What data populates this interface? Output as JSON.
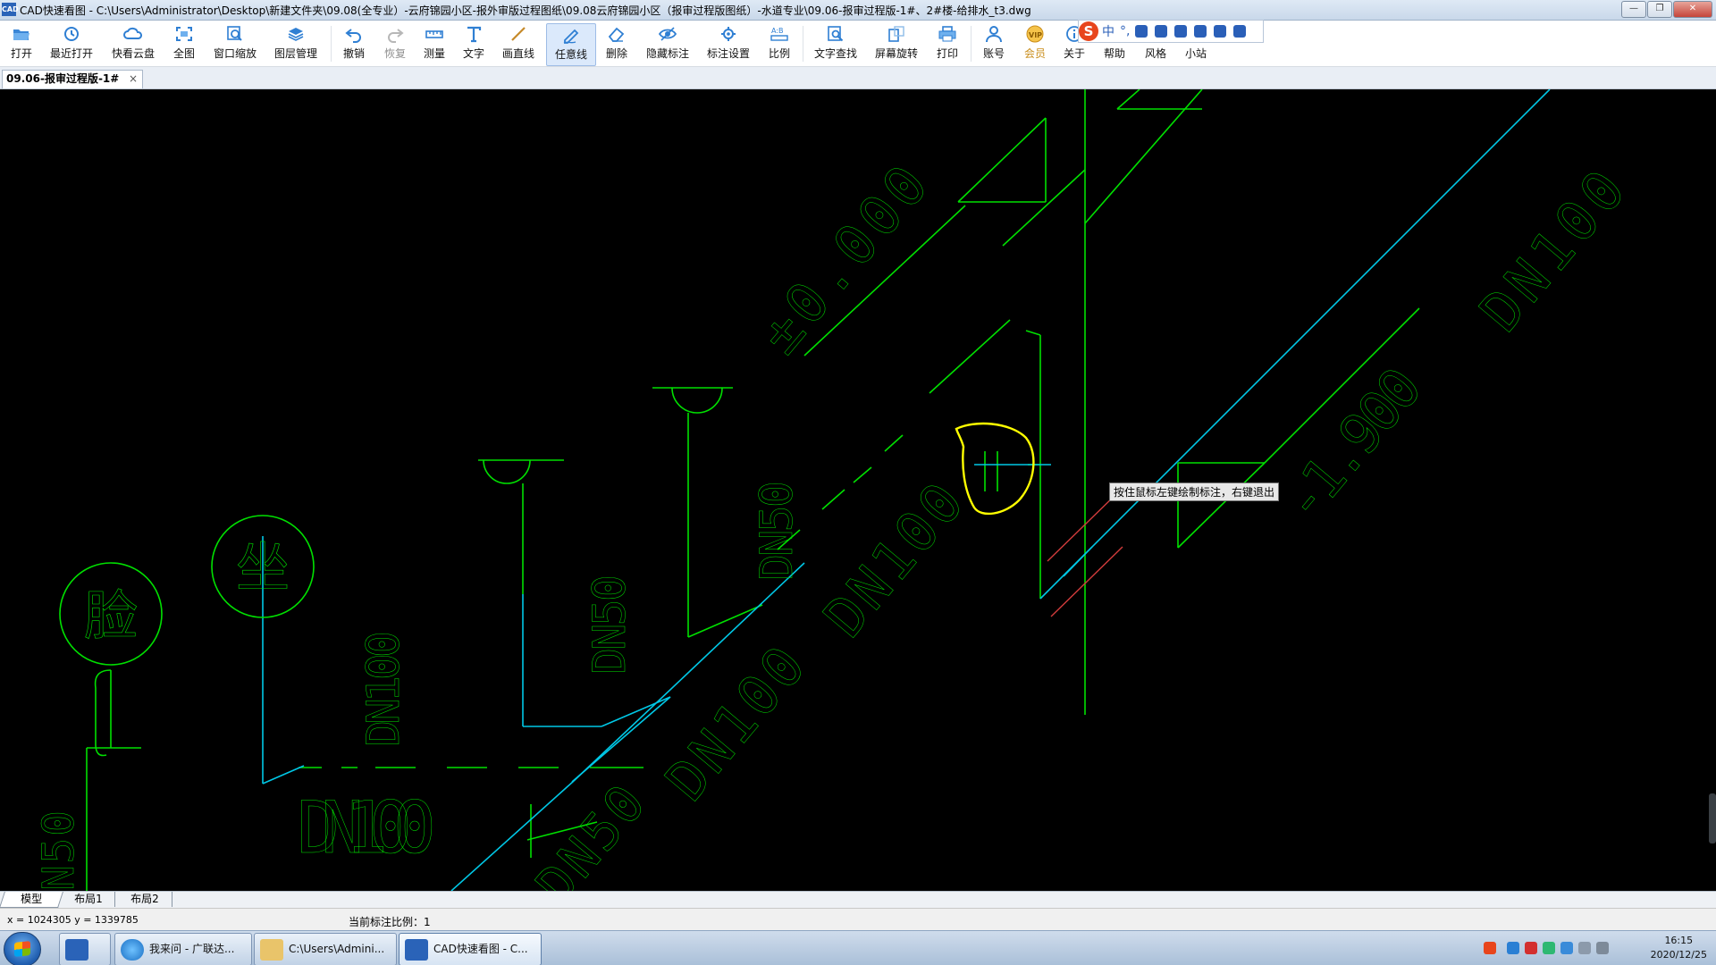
{
  "window": {
    "app_icon_text": "CAD",
    "title": "CAD快速看图 - C:\\Users\\Administrator\\Desktop\\新建文件夹\\09.08(全专业）-云府锦园小区-报外审版过程图纸\\09.08云府锦园小区（报审过程版图纸）-水道专业\\09.06-报审过程版-1#、2#楼-给排水_t3.dwg",
    "controls": [
      "minimize",
      "maximize",
      "close"
    ]
  },
  "toolbar": {
    "items": [
      {
        "label": "打开",
        "icon": "folder-open-icon"
      },
      {
        "label": "最近打开",
        "icon": "recent-icon"
      },
      {
        "label": "快看云盘",
        "icon": "cloud-icon"
      },
      {
        "label": "全图",
        "icon": "fit-all-icon"
      },
      {
        "label": "窗口缩放",
        "icon": "window-zoom-icon"
      },
      {
        "label": "图层管理",
        "icon": "layers-icon"
      },
      {
        "label": "撤销",
        "icon": "undo-icon"
      },
      {
        "label": "恢复",
        "icon": "redo-icon",
        "disabled": true
      },
      {
        "label": "测量",
        "icon": "measure-icon"
      },
      {
        "label": "文字",
        "icon": "text-icon"
      },
      {
        "label": "画直线",
        "icon": "line-icon"
      },
      {
        "label": "任意线",
        "icon": "freehand-icon",
        "active": true
      },
      {
        "label": "删除",
        "icon": "eraser-icon"
      },
      {
        "label": "隐藏标注",
        "icon": "eye-hide-icon"
      },
      {
        "label": "标注设置",
        "icon": "annotation-settings-icon"
      },
      {
        "label": "比例",
        "icon": "scale-icon"
      },
      {
        "label": "文字查找",
        "icon": "text-search-icon"
      },
      {
        "label": "屏幕旋转",
        "icon": "rotate-screen-icon"
      },
      {
        "label": "打印",
        "icon": "print-icon"
      },
      {
        "label": "账号",
        "icon": "account-icon"
      },
      {
        "label": "会员",
        "icon": "vip-icon",
        "vip": true
      },
      {
        "label": "关于",
        "icon": "about-icon"
      },
      {
        "label": "帮助",
        "icon": "help-icon"
      },
      {
        "label": "风格",
        "icon": "style-icon"
      },
      {
        "label": "小站",
        "icon": "site-icon"
      }
    ]
  },
  "ime_bar": {
    "logo": "S",
    "mode": "中",
    "punct": "°,"
  },
  "document_tab": {
    "label": "09.06-报审过程版-1#",
    "close": "×"
  },
  "canvas": {
    "tooltip": "按住鼠标左键绘制标注，右键退出",
    "labels": {
      "elev_top": "±0.000",
      "elev_bottom": "-1.900",
      "dn100_a": "DN100",
      "dn100_b": "DN100",
      "dn100_c": "DN100",
      "dn100_d": "DN100",
      "dn100_e": "DN100",
      "dn50_a": "DN50",
      "dn50_b": "DN50",
      "dn50_c": "DN50",
      "dn50_left": "N50",
      "fixture_basin": "脸",
      "fixture_toilet": "坐"
    },
    "colors": {
      "pipe_green": "#00e000",
      "pipe_cyan": "#00c8e6",
      "markup_yellow": "#ffff00",
      "accent_red": "#d23c3c"
    }
  },
  "layout_tabs": [
    "模型",
    "布局1",
    "布局2"
  ],
  "status": {
    "coords": "x = 1024305  y = 1339785",
    "scale": "当前标注比例：1"
  },
  "taskbar": {
    "items": [
      {
        "label": "",
        "icon": "cad-pinned-icon"
      },
      {
        "label": "我来问 - 广联达...",
        "icon": "ie-icon"
      },
      {
        "label": "C:\\Users\\Admini...",
        "icon": "explorer-folder-icon"
      },
      {
        "label": "CAD快速看图 - C...",
        "icon": "cad-app-icon",
        "active": true
      }
    ],
    "clock_time": "16:15",
    "clock_date": "2020/12/25"
  }
}
